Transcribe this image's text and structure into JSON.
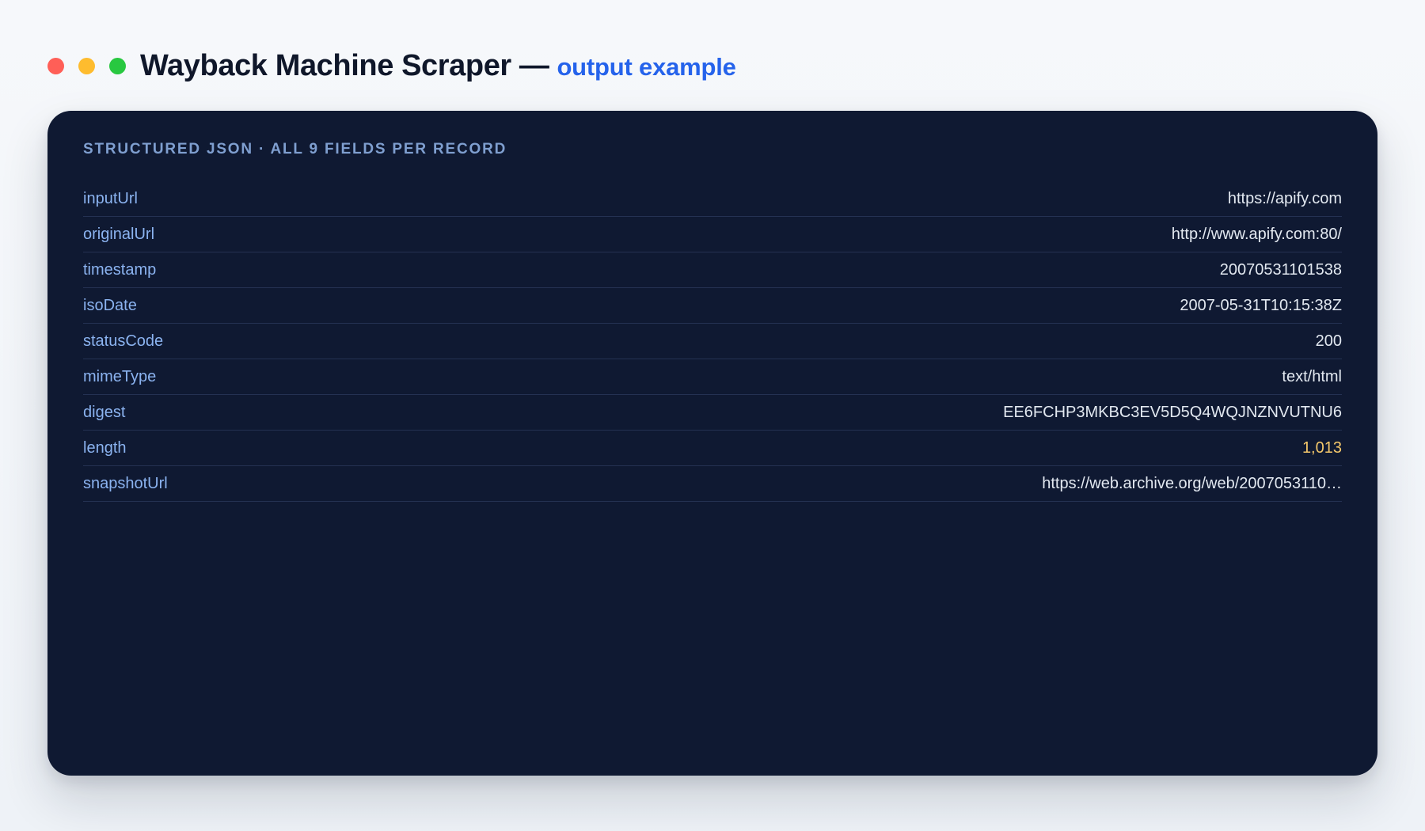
{
  "window_controls": {
    "close_color": "#ff5f57",
    "minimize_color": "#febc2e",
    "maximize_color": "#28c840"
  },
  "header": {
    "title": "Wayback Machine Scraper",
    "dash": "—",
    "subtitle": "output example",
    "subtitle_color": "#2563eb"
  },
  "card": {
    "heading": "STRUCTURED JSON · ALL 9 FIELDS PER RECORD",
    "fields": [
      {
        "key": "inputUrl",
        "value": "https://apify.com"
      },
      {
        "key": "originalUrl",
        "value": "http://www.apify.com:80/"
      },
      {
        "key": "timestamp",
        "value": "20070531101538"
      },
      {
        "key": "isoDate",
        "value": "2007-05-31T10:15:38Z"
      },
      {
        "key": "statusCode",
        "value": "200"
      },
      {
        "key": "mimeType",
        "value": "text/html"
      },
      {
        "key": "digest",
        "value": "EE6FCHP3MKBC3EV5D5Q4WQJNZNVUTNU6"
      },
      {
        "key": "length",
        "value": "1,013"
      },
      {
        "key": "snapshotUrl",
        "value": "https://web.archive.org/web/2007053110…"
      }
    ]
  }
}
